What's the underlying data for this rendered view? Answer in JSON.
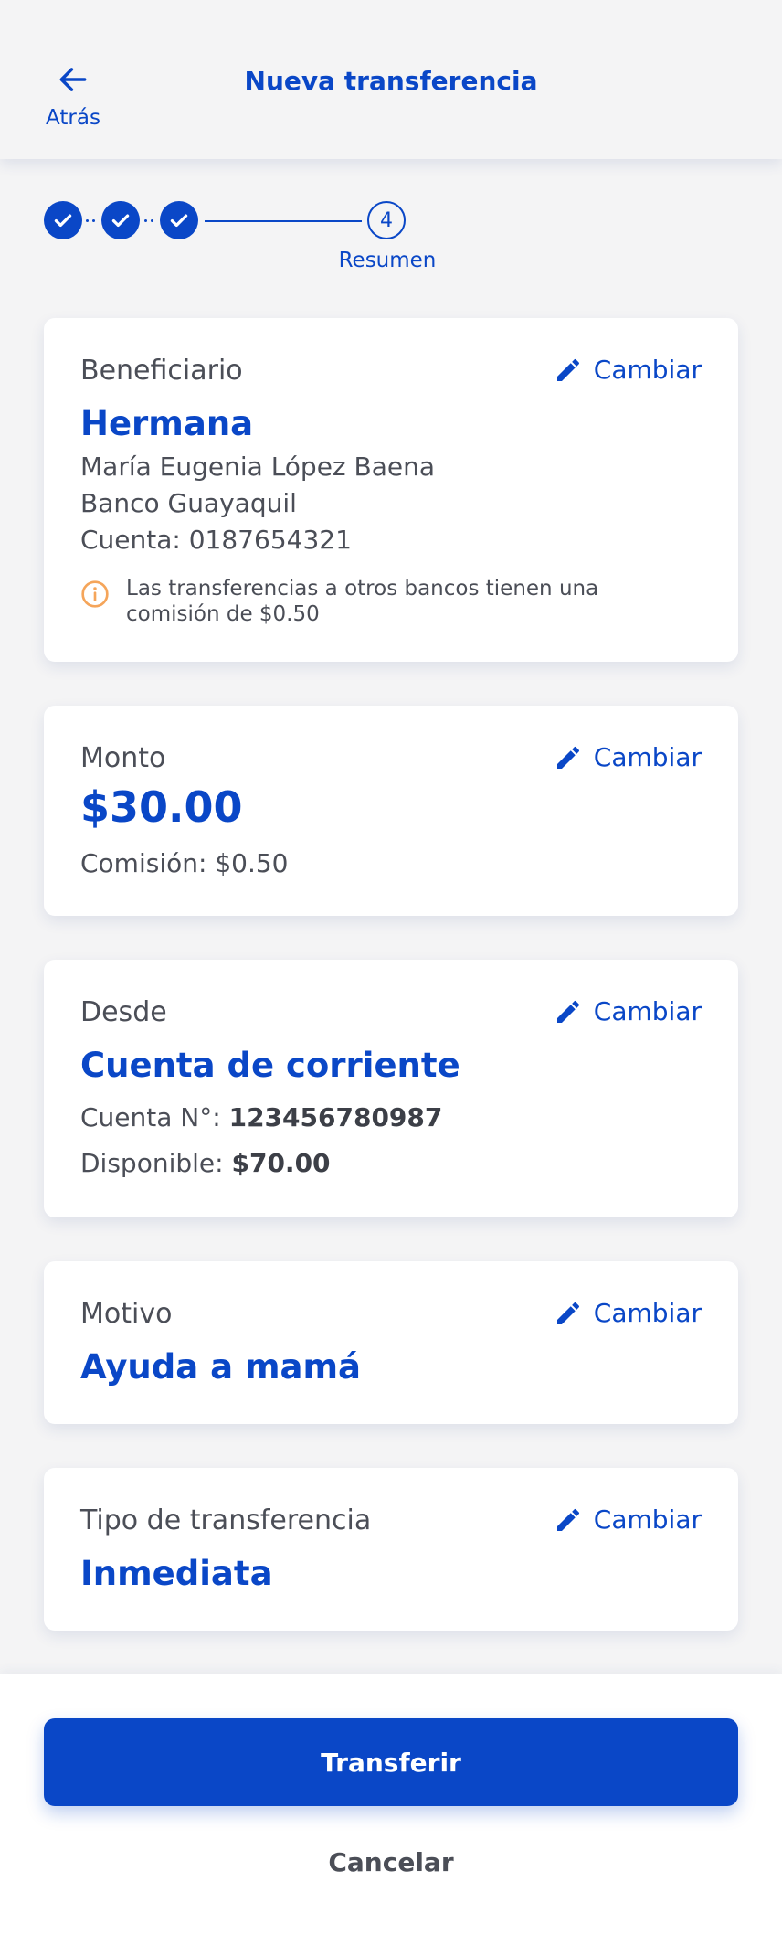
{
  "header": {
    "title": "Nueva transferencia",
    "back_label": "Atrás",
    "back_icon": "arrow-left-icon"
  },
  "stepper": {
    "current_step": "4",
    "current_label": "Resumen",
    "completed_steps": 3
  },
  "beneficiary": {
    "label": "Beneficiario",
    "change_label": "Cambiar",
    "alias": "Hermana",
    "name": "María Eugenia López Baena",
    "bank": "Banco Guayaquil",
    "account": "Cuenta: 0187654321",
    "notice": "Las transferencias a otros bancos tienen una comisión de $0.50"
  },
  "amount": {
    "label": "Monto",
    "change_label": "Cambiar",
    "value": "$30.00",
    "fee": "Comisión: $0.50"
  },
  "source": {
    "label": "Desde",
    "change_label": "Cambiar",
    "account_type": "Cuenta de corriente",
    "account_number_label": "Cuenta N°:",
    "account_number": "123456780987",
    "available_label": "Disponible:",
    "available": "$70.00"
  },
  "reason": {
    "label": "Motivo",
    "change_label": "Cambiar",
    "value": "Ayuda a mamá"
  },
  "transfer_type": {
    "label": "Tipo de transferencia",
    "change_label": "Cambiar",
    "value": "Inmediata"
  },
  "actions": {
    "submit_label": "Transferir",
    "cancel_label": "Cancelar"
  },
  "colors": {
    "primary": "#0a47c7",
    "warning": "#f5a55a",
    "background": "#f4f4f5"
  }
}
